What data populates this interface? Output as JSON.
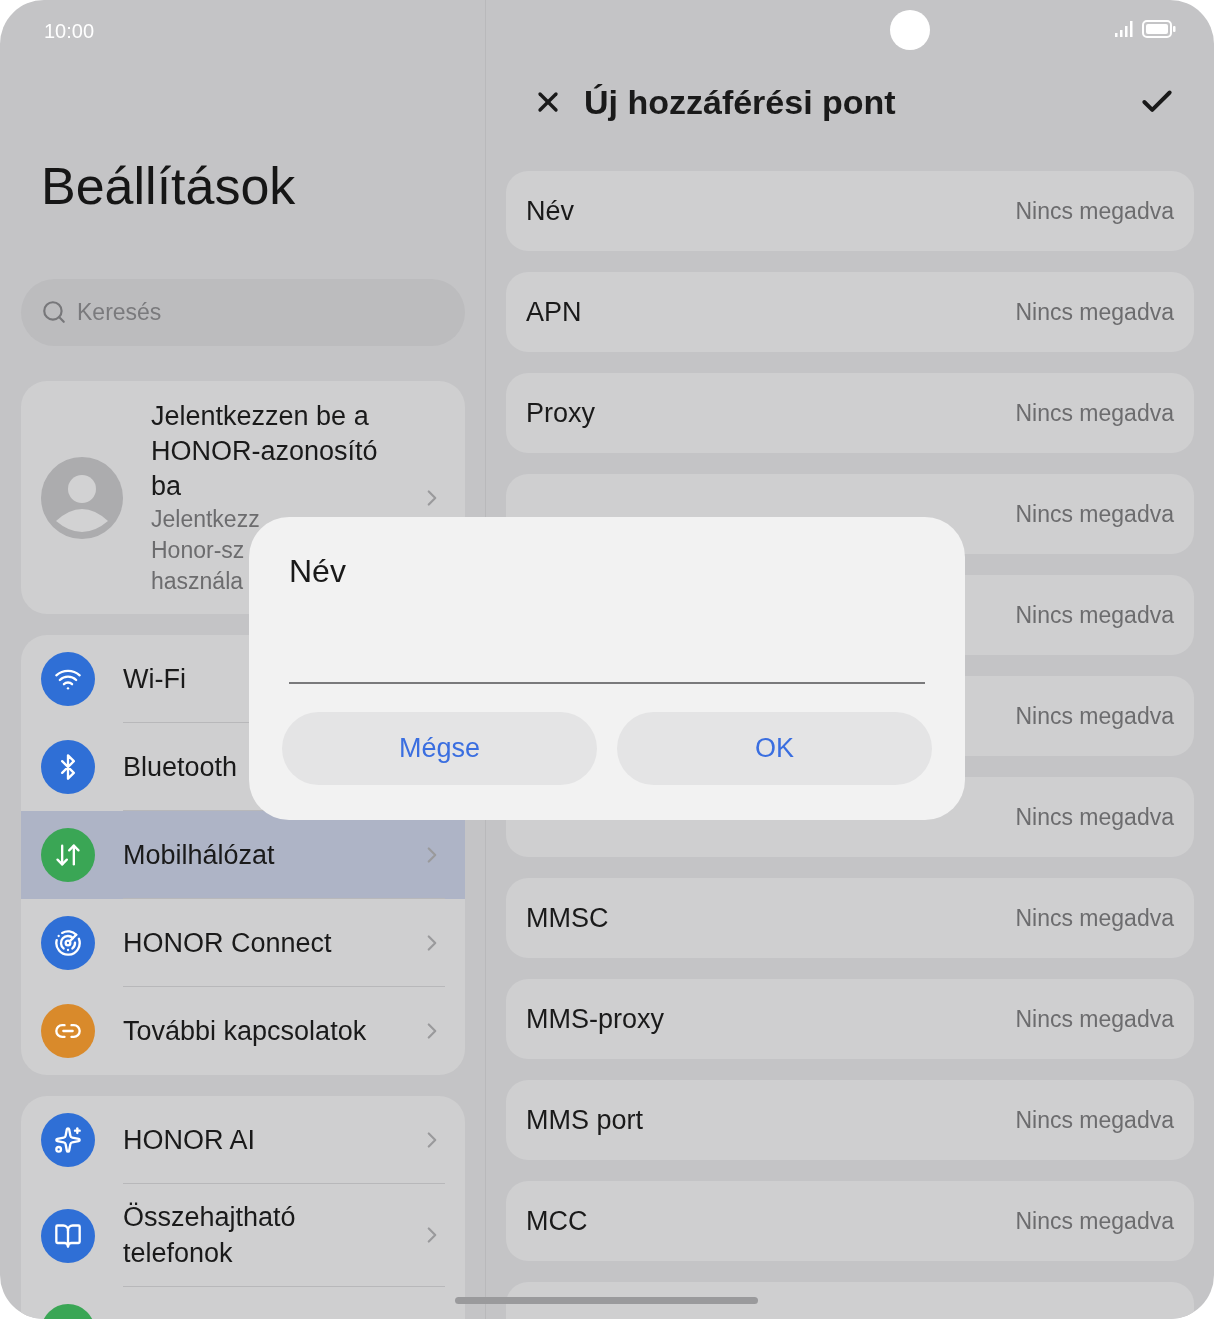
{
  "status_bar": {
    "time": "10:00"
  },
  "settings": {
    "title": "Beállítások",
    "search": {
      "placeholder": "Keresés"
    },
    "account": {
      "title_lines": [
        "Jelentkezzen be a",
        "HONOR-azonosító",
        "ba"
      ],
      "subtitle_lines": [
        "Jelentkezz",
        "Honor-sz",
        "használa"
      ]
    },
    "groups": [
      {
        "items": [
          {
            "kind": "wifi",
            "label": "Wi-Fi",
            "color": "#2f6fd6",
            "selected": false,
            "chevron": false
          },
          {
            "kind": "bluetooth",
            "label": "Bluetooth",
            "color": "#2f6fd6",
            "selected": false,
            "chevron": false
          },
          {
            "kind": "mobile",
            "label": "Mobilhálózat",
            "color": "#3aa655",
            "selected": true,
            "chevron": true
          },
          {
            "kind": "connect",
            "label": "HONOR Connect",
            "color": "#2f6fd6",
            "selected": false,
            "chevron": true
          },
          {
            "kind": "link",
            "label": "További kapcsolatok",
            "color": "#d98a2b",
            "selected": false,
            "chevron": true
          }
        ]
      },
      {
        "items": [
          {
            "kind": "ai",
            "label": "HONOR AI",
            "color": "#2f6fd6",
            "selected": false,
            "chevron": true
          },
          {
            "kind": "fold",
            "label": "Összehajtható telefonok",
            "color": "#2f6fd6",
            "selected": false,
            "chevron": true
          },
          {
            "kind": "app",
            "color": "#3aa655",
            "selected": false,
            "chevron": false
          }
        ]
      }
    ]
  },
  "apn": {
    "title": "Új hozzáférési pont",
    "fields": [
      {
        "label": "Név",
        "value": "Nincs megadva"
      },
      {
        "label": "APN",
        "value": "Nincs megadva"
      },
      {
        "label": "Proxy",
        "value": "Nincs megadva"
      },
      {
        "value": "Nincs megadva"
      },
      {
        "value": "Nincs megadva"
      },
      {
        "value": "Nincs megadva"
      },
      {
        "value": "Nincs megadva"
      },
      {
        "label": "MMSC",
        "value": "Nincs megadva"
      },
      {
        "label": "MMS-proxy",
        "value": "Nincs megadva"
      },
      {
        "label": "MMS port",
        "value": "Nincs megadva"
      },
      {
        "label": "MCC",
        "value": "Nincs megadva"
      }
    ],
    "more_below": true
  },
  "dialog": {
    "title": "Név",
    "buttons": [
      "Mégse",
      "OK"
    ]
  }
}
